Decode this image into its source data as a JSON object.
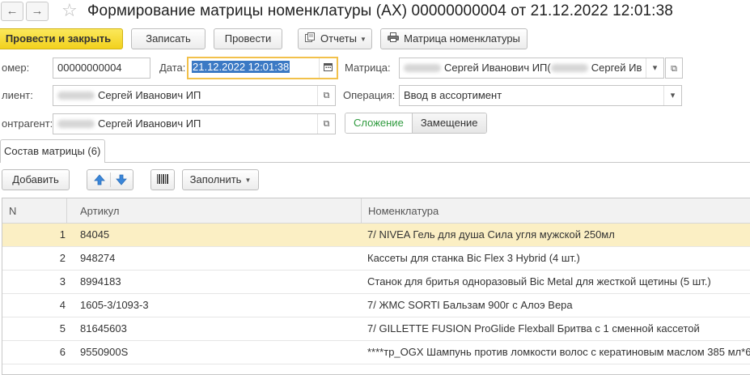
{
  "header": {
    "back_glyph": "←",
    "forward_glyph": "→",
    "favorite_glyph": "☆",
    "title": "Формирование матрицы номенклатуры (АХ) 00000000004 от 21.12.2022 12:01:38"
  },
  "toolbar": {
    "post_and_close": "Провести и закрыть",
    "write": "Записать",
    "post": "Провести",
    "reports": "Отчеты",
    "matrix": "Матрица номенклатуры",
    "reports_icon": "reports-icon",
    "printer_icon": "printer-icon"
  },
  "form": {
    "number_label": "омер:",
    "number_value": "00000000004",
    "date_label": "Дата:",
    "date_value": "21.12.2022 12:01:38",
    "matrix_label": "Матрица:",
    "matrix_value_a": "Сергей Иванович ИП(",
    "matrix_value_b": "Сергей Ив",
    "client_label": "лиент:",
    "client_value": "Сергей Иванович ИП",
    "operation_label": "Операция:",
    "operation_value": "Ввод в ассортимент",
    "contractor_label": "онтрагент:",
    "contractor_value": "Сергей Иванович ИП",
    "mode_add": "Сложение",
    "mode_replace": "Замещение"
  },
  "tabs": {
    "composition": "Состав матрицы (6)"
  },
  "table_toolbar": {
    "add": "Добавить",
    "fill": "Заполнить"
  },
  "table": {
    "columns": [
      "N",
      "Артикул",
      "Номенклатура"
    ],
    "rows": [
      {
        "n": "1",
        "article": "84045",
        "item": "7/ NIVEA Гель для душа Сила угля мужской 250мл"
      },
      {
        "n": "2",
        "article": "948274",
        "item": "Кассеты для станка Bic Flex 3 Hybrid (4 шт.)"
      },
      {
        "n": "3",
        "article": "8994183",
        "item": "Станок для бритья одноразовый Bic Metal для жесткой щетины (5 шт.)"
      },
      {
        "n": "4",
        "article": "1605-3/1093-3",
        "item": "7/ ЖМС SORTI Бальзам 900г с Алоэ Вера"
      },
      {
        "n": "5",
        "article": "81645603",
        "item": "7/ GILLETTE FUSION ProGlide Flexball Бритва с 1 сменной кассетой"
      },
      {
        "n": "6",
        "article": "9550900S",
        "item": "****тр_OGX Шампунь против ломкости волос с кератиновым маслом 385 мл*6"
      }
    ],
    "selected_row": 1
  },
  "colors": {
    "primary_button": "#f2d11d",
    "selected_row": "#fbefc4",
    "active_field_border": "#f2c14b",
    "toggle_on_text": "#2e9a3d"
  }
}
